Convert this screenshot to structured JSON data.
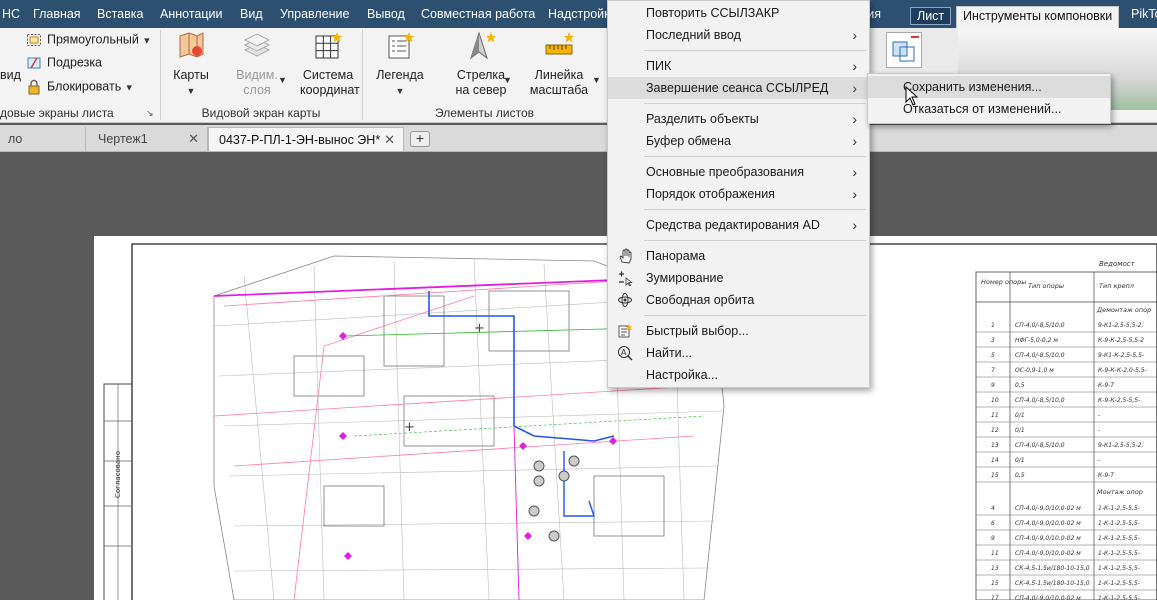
{
  "ribbon_tabs": [
    {
      "label": "НС",
      "state": "normal"
    },
    {
      "label": "Главная",
      "state": "normal"
    },
    {
      "label": "Вставка",
      "state": "normal"
    },
    {
      "label": "Аннотации",
      "state": "normal"
    },
    {
      "label": "Вид",
      "state": "normal"
    },
    {
      "label": "Управление",
      "state": "normal"
    },
    {
      "label": "Вывод",
      "state": "normal"
    },
    {
      "label": "Совместная работа",
      "state": "normal"
    },
    {
      "label": "Надстройк",
      "state": "normal"
    },
    {
      "label": "жения",
      "state": "normal"
    },
    {
      "label": "Лист",
      "state": "boxed"
    },
    {
      "label": "Инструменты компоновки",
      "state": "active"
    },
    {
      "label": "PikTo",
      "state": "normal"
    }
  ],
  "ribbon": {
    "layout_viewports": {
      "vid_label": "вид",
      "rect_label": "Прямоугольный",
      "clip_label": "Подрезка",
      "lock_label": "Блокировать",
      "panel_title": "довые экраны листа"
    },
    "map_viewport": {
      "maps_label": "Карты",
      "visible_layers_label_1": "Видим.",
      "visible_layers_label_2": "слоя",
      "coord_label_1": "Система",
      "coord_label_2": "координат",
      "panel_title": "Видовой экран карты"
    },
    "layout_elements": {
      "legend_label": "Легенда",
      "north_label_1": "Стрелка",
      "north_label_2": "на север",
      "scale_label_1": "Линейка",
      "scale_label_2": "масштаба",
      "panel_title": "Элементы листов"
    }
  },
  "doc_tabs": [
    {
      "label": "ло",
      "active": false
    },
    {
      "label": "Чертеж1",
      "active": false
    },
    {
      "label": "0437-Р-ПЛ-1-ЭН-вынос ЭН*",
      "active": true
    }
  ],
  "context_menu": {
    "items": [
      {
        "label": "Повторить ССЫЛЗАКР",
        "submenu": false,
        "icon": ""
      },
      {
        "label": "Последний ввод",
        "submenu": true,
        "icon": ""
      },
      {
        "sep": true
      },
      {
        "label": "ПИК",
        "submenu": true,
        "icon": ""
      },
      {
        "label": "Завершение сеанса ССЫЛРЕД",
        "submenu": true,
        "icon": "",
        "highlight": true
      },
      {
        "sep": true
      },
      {
        "label": "Разделить объекты",
        "submenu": true,
        "icon": ""
      },
      {
        "label": "Буфер обмена",
        "submenu": true,
        "icon": ""
      },
      {
        "sep": true
      },
      {
        "label": "Основные преобразования",
        "submenu": true,
        "icon": ""
      },
      {
        "label": "Порядок отображения",
        "submenu": true,
        "icon": ""
      },
      {
        "sep": true
      },
      {
        "label": "Средства редактирования AD",
        "submenu": true,
        "icon": ""
      },
      {
        "sep": true
      },
      {
        "label": "Панорама",
        "submenu": false,
        "icon": "pan-hand-icon"
      },
      {
        "label": "Зумирование",
        "submenu": false,
        "icon": "zoom-icon"
      },
      {
        "label": "Свободная орбита",
        "submenu": false,
        "icon": "orbit-icon"
      },
      {
        "sep": true
      },
      {
        "label": "Быстрый выбор...",
        "submenu": false,
        "icon": "quick-select-icon"
      },
      {
        "label": "Найти...",
        "submenu": false,
        "icon": "find-icon"
      },
      {
        "label": "Настройка...",
        "submenu": false,
        "icon": ""
      }
    ]
  },
  "submenu": {
    "items": [
      {
        "label": "Сохранить изменения...",
        "highlight": true
      },
      {
        "label": "Отказаться от изменений..."
      }
    ]
  },
  "drawing_table": {
    "title": "Ведомост",
    "headers": [
      "Номер опоры",
      "Тип опоры",
      "Тип крепл"
    ],
    "section_1": "Демонтаж опор",
    "section_2": "Монтаж опор",
    "rows_1": [
      [
        "1",
        "СП-4,0/-8,5/10,0",
        "9-К1-2,5-5,5-2,"
      ],
      [
        "3",
        "НФГ-5,0-0,2 м",
        "К-9-К-2,5-5,5-2"
      ],
      [
        "5",
        "СП-4,0/-8,5/10,0",
        "9-К1-К-2,5-5,5-"
      ],
      [
        "7",
        "ОС-0,9-1,0 м",
        "К-9-К-К-2,0-5,5-"
      ],
      [
        "9",
        "0,5",
        "К-9-Т"
      ],
      [
        "10",
        "СП-4,0/-8,5/10,0",
        "К-9-К-2,5-5,5-"
      ],
      [
        "11",
        "0/1",
        "-"
      ],
      [
        "12",
        "0/1",
        "-"
      ],
      [
        "13",
        "СП-4,0/-8,5/10,0",
        "9-К1-2,5-5,5-2,"
      ],
      [
        "14",
        "0/1",
        "-"
      ],
      [
        "15",
        "0,5",
        "К-9-Т"
      ]
    ],
    "rows_2": [
      [
        "4",
        "СП-4,0/-9,0/10,0-02 м",
        "1-К-1-2,5-5,5-"
      ],
      [
        "6",
        "СП-4,0/-9,0/10,0-02 м",
        "1-К-1-2,5-5,5-"
      ],
      [
        "9",
        "СП-4,0/-9,0/10,0-02 м",
        "1-К-1-2,5-5,5-"
      ],
      [
        "11",
        "СП-4,0/-9,0/10,0-02 м",
        "1-К-1-2,5-5,5-"
      ],
      [
        "13",
        "СК-4,5-1,5и/180-10-15,0",
        "1-К-1-2,5-5,5-"
      ],
      [
        "15",
        "СК-4,5-1,5и/180-10-15,0",
        "1-К-1-2,5-5,5-"
      ],
      [
        "17",
        "СП-4,0/-9,0/10,0-02 м",
        "1-К-1-2,5-5,5-"
      ]
    ]
  },
  "drawing_left_label": "Согласовано",
  "colors": {
    "ribbon_tab_bg": "#2d4f70",
    "magenta": "#e01ee0",
    "blue_route": "#2255ee",
    "pink_line": "#ff7aa8",
    "green_line": "#33b833"
  }
}
